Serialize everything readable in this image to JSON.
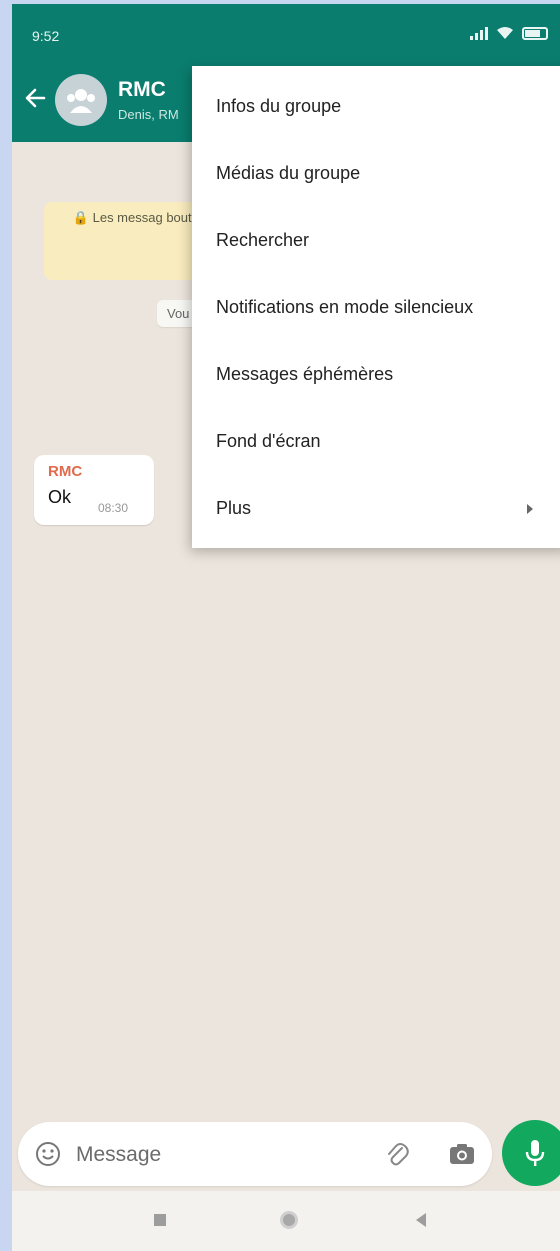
{
  "status_bar": {
    "time": "9:52",
    "battery": "82"
  },
  "app_bar": {
    "title": "RMC",
    "subtitle": "Denis, RM"
  },
  "chat": {
    "encryption_note": "🔒 Les messag bout. Aucun tiers les écou",
    "system_message": "Vou",
    "message": {
      "sender": "RMC",
      "text": "Ok",
      "time": "08:30"
    }
  },
  "menu": {
    "items": [
      {
        "label": "Infos du groupe"
      },
      {
        "label": "Médias du groupe"
      },
      {
        "label": "Rechercher"
      },
      {
        "label": "Notifications en mode silencieux"
      },
      {
        "label": "Messages éphémères"
      },
      {
        "label": "Fond d'écran"
      },
      {
        "label": "Plus",
        "has_submenu": true
      }
    ]
  },
  "composer": {
    "placeholder": "Message"
  },
  "colors": {
    "header": "#0a7d6e",
    "mic_button": "#12a85e",
    "sender_name": "#e06b4d"
  }
}
